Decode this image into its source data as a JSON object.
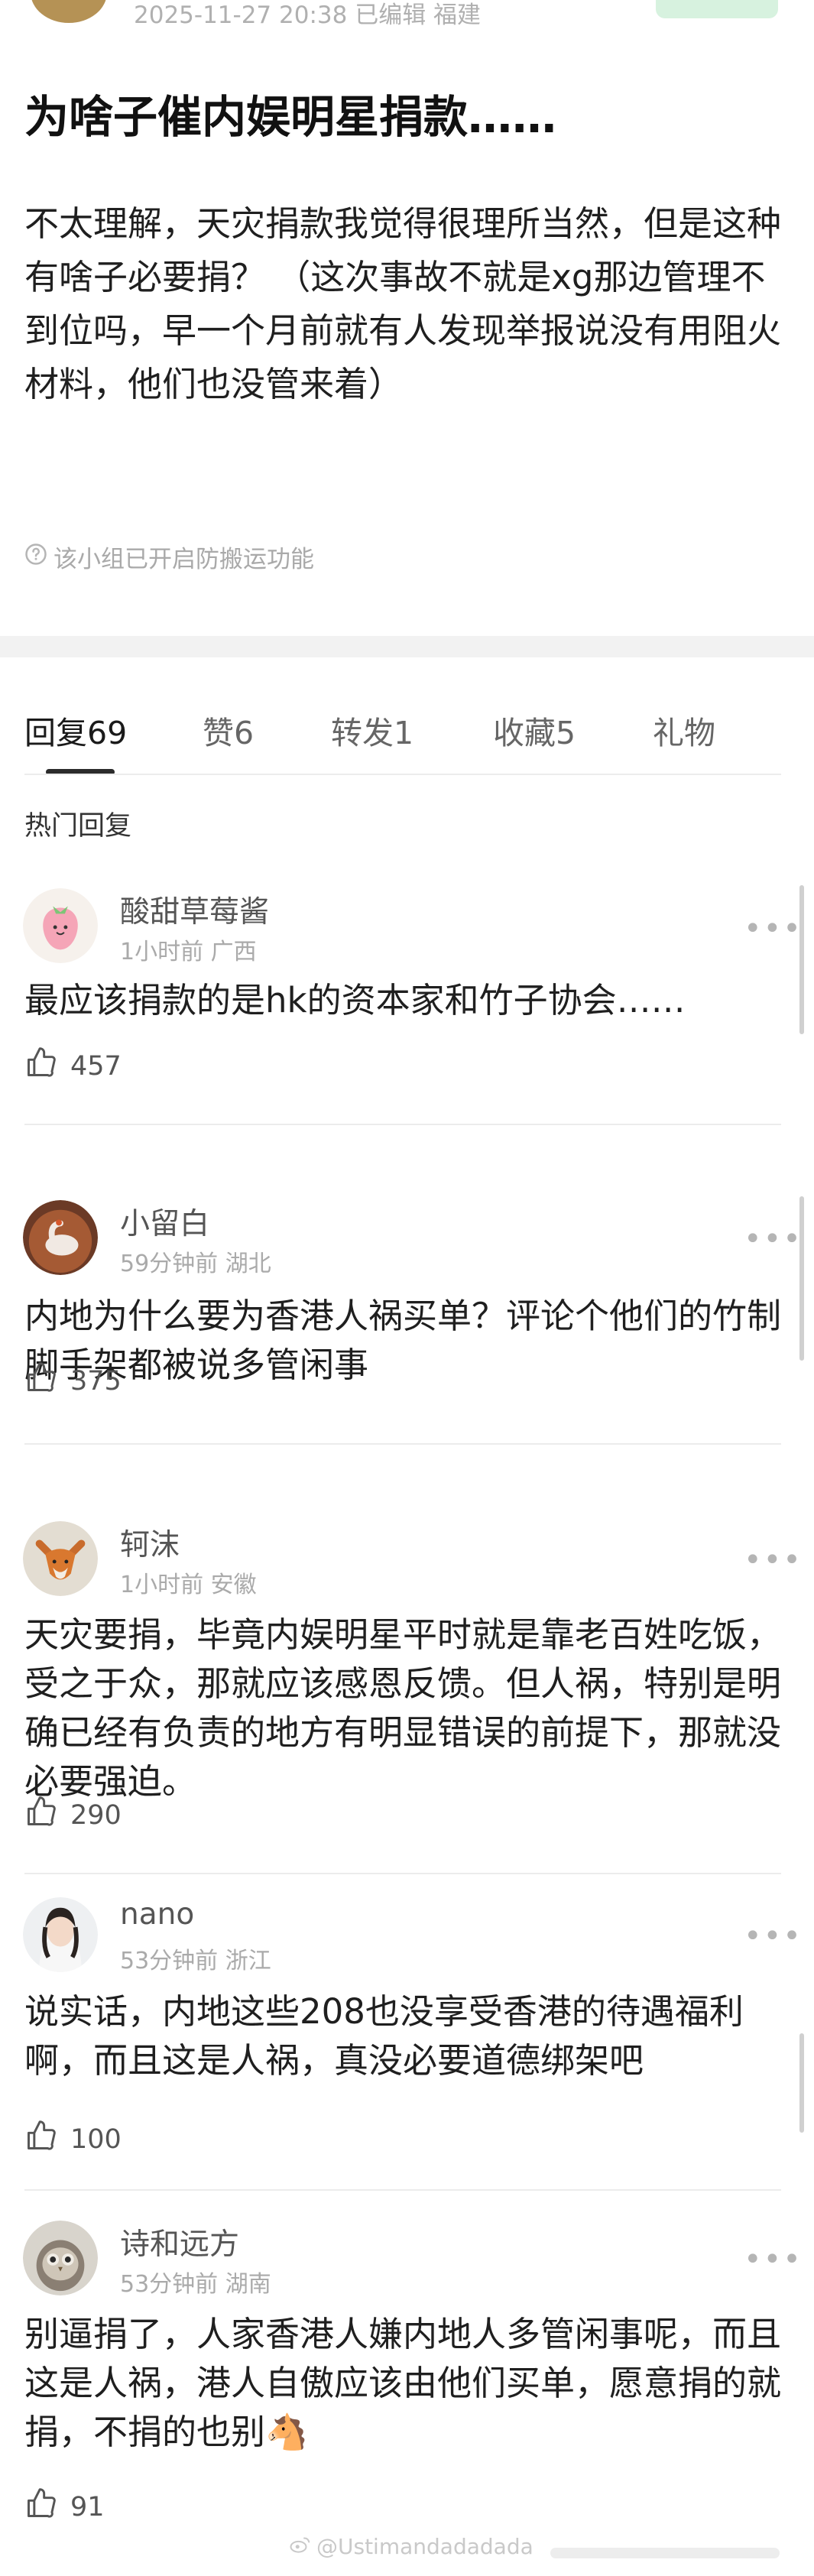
{
  "post": {
    "meta": "2025-11-27 20:38  已编辑  福建",
    "title": "为啥子催内娱明星捐款……",
    "body": "不太理解，天灾捐款我觉得很理所当然，但是这种有啥子必要捐？ （这次事故不就是xg那边管理不到位吗，早一个月前就有人发现举报说没有用阻火材料，他们也没管来着）",
    "notice": "该小组已开启防搬运功能"
  },
  "tabs": [
    {
      "label": "回复",
      "count": "69"
    },
    {
      "label": "赞",
      "count": "6"
    },
    {
      "label": "转发",
      "count": "1"
    },
    {
      "label": "收藏",
      "count": "5"
    },
    {
      "label": "礼物",
      "count": ""
    }
  ],
  "section_label": "热门回复",
  "comments": [
    {
      "name": "酸甜草莓酱",
      "meta": "1小时前 广西",
      "text": "最应该捐款的是hk的资本家和竹子协会……",
      "likes": "457",
      "avatar": "strawberry-icon"
    },
    {
      "name": "小留白",
      "meta": "59分钟前 湖北",
      "text": "内地为什么要为香港人祸买单？评论个他们的竹制脚手架都被说多管闲事",
      "likes": "375",
      "avatar": "swan-photo"
    },
    {
      "name": "轲沫",
      "meta": "1小时前 安徽",
      "text": "天灾要捐，毕竟内娱明星平时就是靠老百姓吃饭，受之于众，那就应该感恩反馈。但人祸，特别是明确已经有负责的地方有明显错误的前提下，那就没必要强迫。",
      "likes": "290",
      "avatar": "fox-photo"
    },
    {
      "name": "nano",
      "meta": "53分钟前 浙江",
      "text": "说实话，内地这些208也没享受香港的待遇福利啊，而且这是人祸，真没必要道德绑架吧",
      "likes": "100",
      "avatar": "girl-photo"
    },
    {
      "name": "诗和远方",
      "meta": "53分钟前 湖南",
      "text": "别逼捐了，人家香港人嫌内地人多管闲事呢，而且这是人祸，港人自傲应该由他们买单，愿意捐的就捐，不捐的也别🐴",
      "likes": "91",
      "avatar": "owl-photo"
    }
  ],
  "more_glyph": "•••",
  "watermark": "@Ustimandadadada"
}
